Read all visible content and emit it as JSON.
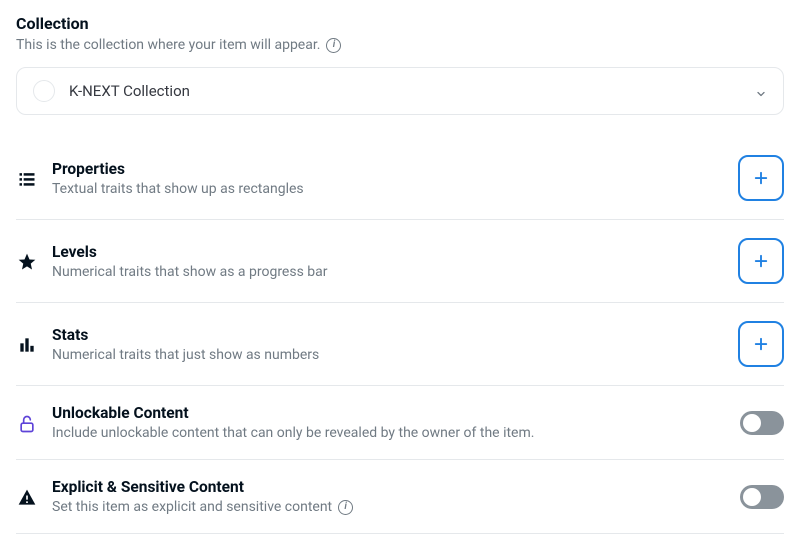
{
  "collection": {
    "title": "Collection",
    "subtitle": "This is the collection where your item will appear.",
    "selected": "K-NEXT Collection"
  },
  "traits": {
    "properties": {
      "title": "Properties",
      "desc": "Textual traits that show up as rectangles"
    },
    "levels": {
      "title": "Levels",
      "desc": "Numerical traits that show as a progress bar"
    },
    "stats": {
      "title": "Stats",
      "desc": "Numerical traits that just show as numbers"
    },
    "unlockable": {
      "title": "Unlockable Content",
      "desc": "Include unlockable content that can only be revealed by the owner of the item."
    },
    "explicit": {
      "title": "Explicit & Sensitive Content",
      "desc": "Set this item as explicit and sensitive content"
    }
  }
}
